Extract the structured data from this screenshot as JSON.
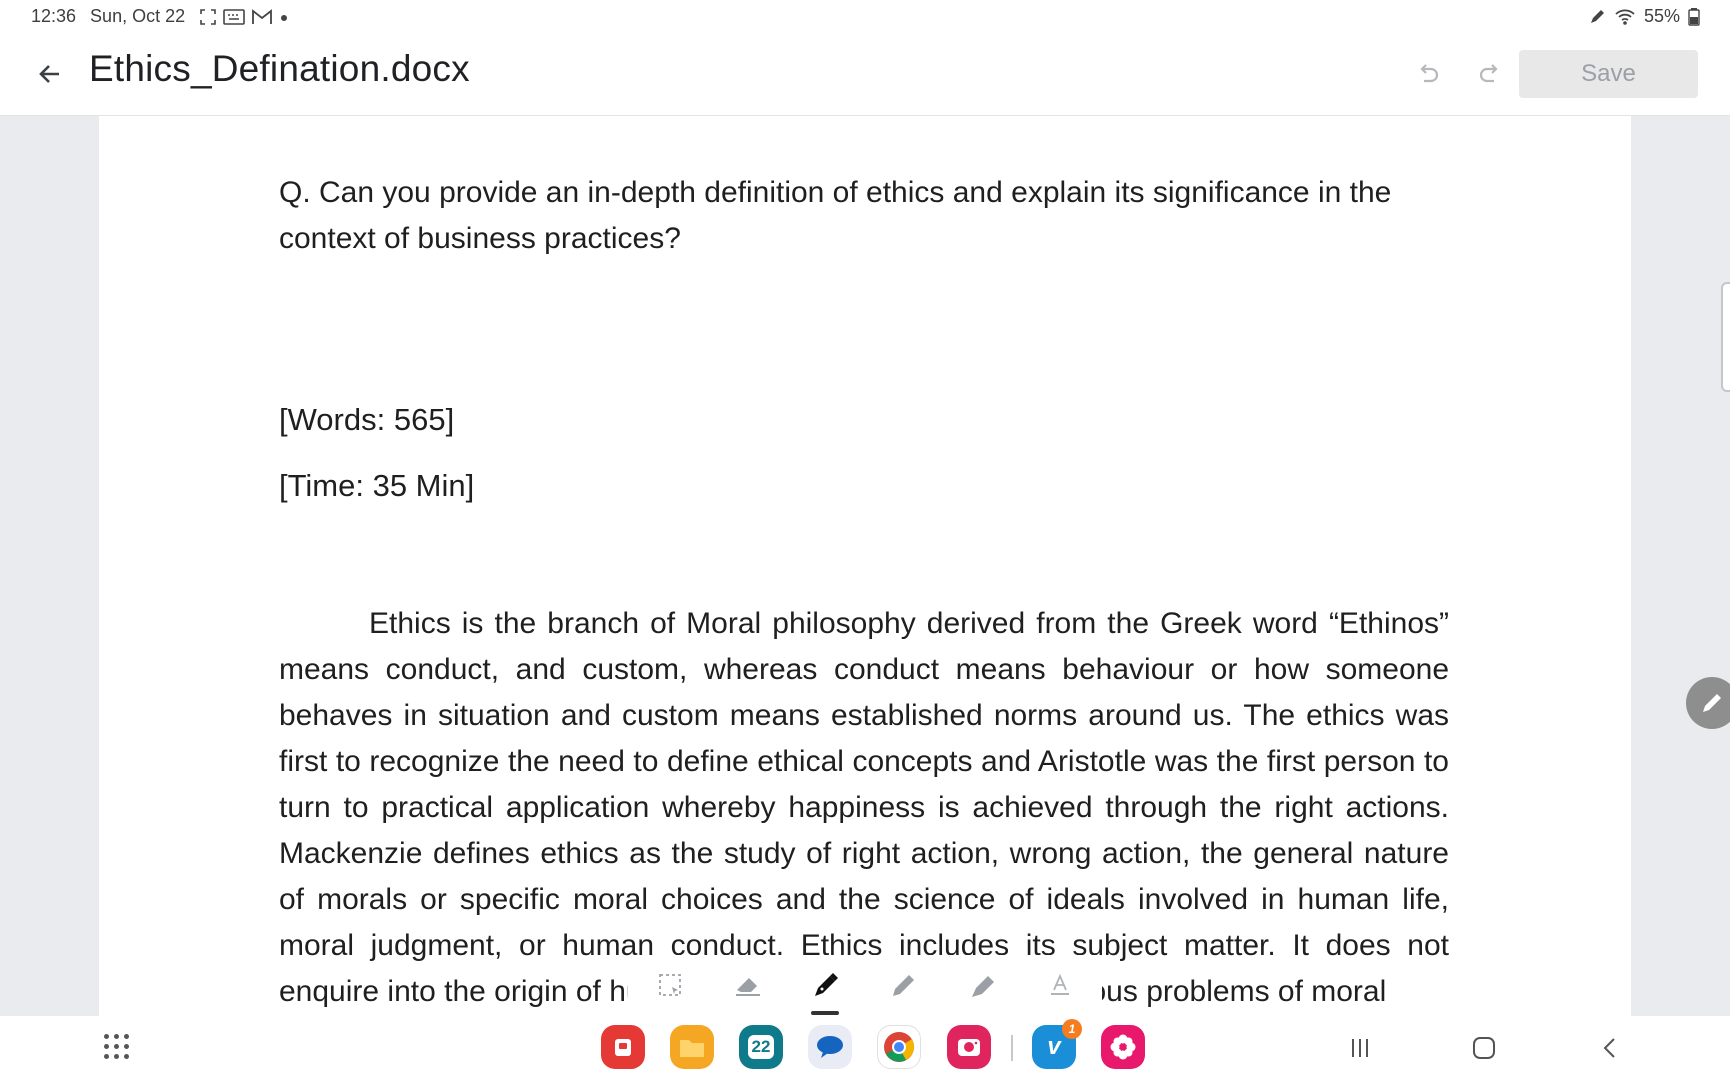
{
  "status_bar": {
    "time": "12:36",
    "date": "Sun, Oct 22",
    "battery": "55%",
    "left_icons": [
      "screenshot-frame-icon",
      "keyboard-icon",
      "gmail-icon",
      "dot-icon"
    ],
    "right_icons": [
      "pen-icon",
      "wifi-icon",
      "battery-icon"
    ]
  },
  "app_bar": {
    "title": "Ethics_Defination.docx",
    "save_label": "Save"
  },
  "document": {
    "question": "Q. Can you provide an in-depth definition of ethics and explain its significance in the context of business practices?",
    "words": "[Words: 565]",
    "time": "[Time: 35 Min]",
    "body": "Ethics is the branch of Moral philosophy derived from the Greek word “Ethinos” means conduct, and custom, whereas conduct means behaviour or how someone behaves in situation and custom means established norms around us. The ethics was first to recognize the need to define ethical concepts and Aristotle was the first person to turn to practical application whereby happiness is achieved through the right actions. Mackenzie defines ethics as the study of right action, wrong action, the general nature of morals or specific moral choices and the science of ideals involved in human life, moral judgment, or human conduct. Ethics includes its subject matter. It does not enquire into the origin of human conduct but emphasizes various problems of moral"
  },
  "pen_toolbar": {
    "tools": [
      "selection-tool",
      "eraser-tool",
      "pen-tool",
      "pencil-tool",
      "highlighter-tool",
      "text-tool"
    ],
    "active_tool": "pen-tool"
  },
  "dock": {
    "apps": [
      {
        "name": "flashcards-app",
        "color": "#e53935",
        "label": ""
      },
      {
        "name": "files-app",
        "color": "#f5a623",
        "label": ""
      },
      {
        "name": "calendar-app",
        "color": "#0f7a8a",
        "label": "22"
      },
      {
        "name": "messages-app",
        "color": "#e9ecf5",
        "label": ""
      },
      {
        "name": "chrome-app",
        "color": "#ffffff",
        "label": ""
      },
      {
        "name": "screen-recorder-app",
        "color": "#e0245e",
        "label": ""
      },
      {
        "name": "vimeo-app",
        "color": "#1a8fd8",
        "label": "v",
        "badge": "1"
      },
      {
        "name": "blossom-app",
        "color": "#e8196c",
        "label": ""
      }
    ]
  }
}
